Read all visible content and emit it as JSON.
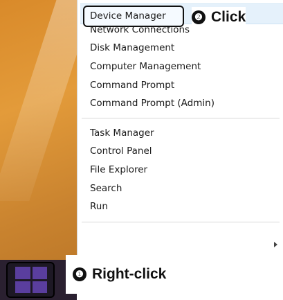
{
  "menu": {
    "group1": [
      "Device Manager",
      "Network Connections",
      "Disk Management",
      "Computer Management",
      "Command Prompt",
      "Command Prompt (Admin)"
    ],
    "group2": [
      "Task Manager",
      "Control Panel",
      "File Explorer",
      "Search",
      "Run"
    ]
  },
  "annotations": {
    "step1_number": "❶",
    "step1_text": "Right-click",
    "step2_number": "❷",
    "step2_text": "Click"
  },
  "icons": {
    "start": "windows-logo-icon",
    "submenu": "chevron-right-icon"
  },
  "colors": {
    "desktop": "#d98a2a",
    "taskbar": "#2a2030",
    "start_tile": "#5a3e9e",
    "highlight": "#e5f1fb"
  }
}
